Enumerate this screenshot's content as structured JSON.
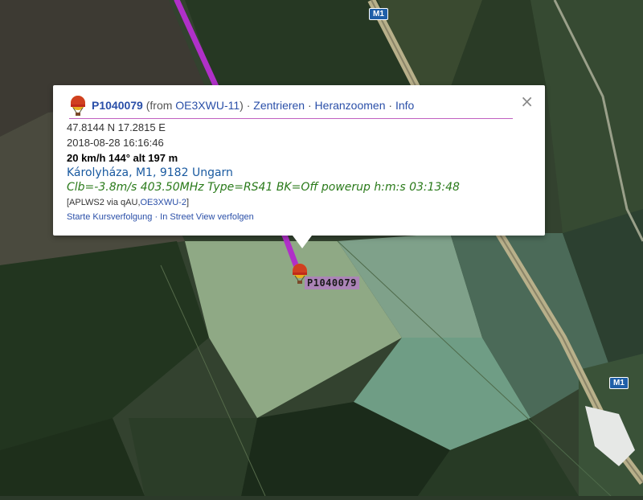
{
  "map": {
    "road_label_top": "M1",
    "road_label_bottom": "M1",
    "track_color": "#b030c8"
  },
  "marker": {
    "icon": "balloon-icon",
    "label": "P1040079"
  },
  "popup": {
    "callsign": "P1040079",
    "from_prefix": "(from ",
    "from_call": "OE3XWU-11",
    "from_suffix": ") · ",
    "link_center": "Zentrieren",
    "sep": " · ",
    "link_zoom": "Heranzoomen",
    "link_info": "Info",
    "coords": "47.8144 N 17.2815 E",
    "timestamp": "2018-08-28 16:16:46",
    "speed_course_alt": "20 km/h 144° alt 197 m",
    "place": "Károlyháza, M1, 9182 Ungarn",
    "comment": "Clb=-3.8m/s 403.50MHz Type=RS41 BK=Off powerup h:m:s 03:13:48",
    "path_prefix": "[APLWS2 via qAU,",
    "path_call": "OE3XWU-2",
    "path_suffix": "]",
    "link_track": "Starte Kursverfolgung",
    "link_streetview": "In Street View verfolgen",
    "close_symbol": "×"
  }
}
